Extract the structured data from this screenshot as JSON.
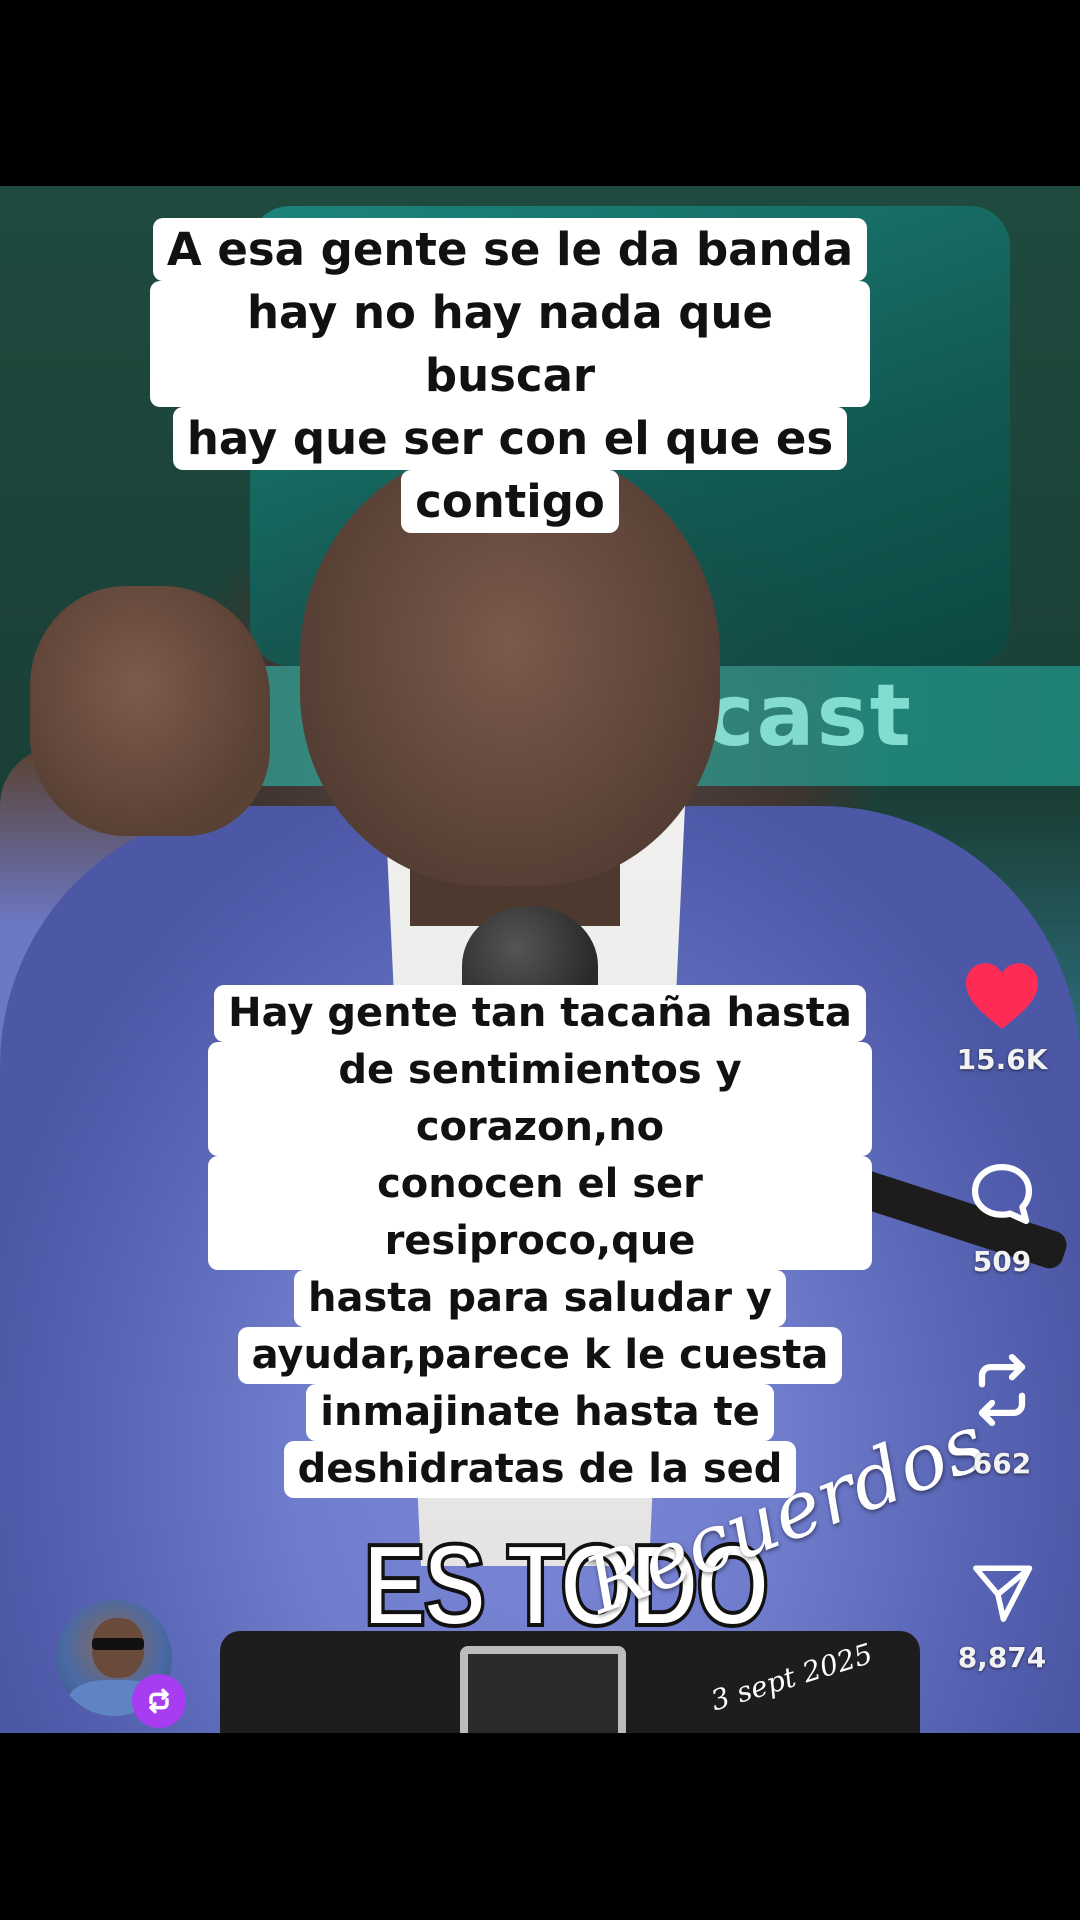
{
  "video": {
    "background_text": "dcast",
    "caption_top": [
      "A esa gente se le da banda",
      "hay no hay nada que buscar",
      "hay que ser con el que es",
      "contigo"
    ],
    "caption_bottom": [
      "Hay gente tan tacaña hasta",
      "de sentimientos y corazon,no",
      "conocen el ser resiproco,que",
      "hasta para saludar y",
      "ayudar,parece k le cuesta",
      "inmajinate hasta te",
      "deshidratas de la sed"
    ],
    "overlay_text": "ES TODO",
    "watermark": "Recuerdos",
    "watermark_date": "3 sept 2025"
  },
  "actions": {
    "like": {
      "icon": "heart-icon",
      "count": "15.6K",
      "color": "#fe2c55"
    },
    "comment": {
      "icon": "comment-icon",
      "count": "509"
    },
    "repost": {
      "icon": "repost-icon",
      "count": "662"
    },
    "share": {
      "icon": "share-icon",
      "count": "8,874"
    }
  },
  "creator": {
    "avatar_icon": "avatar",
    "badge_icon": "repost-icon",
    "badge_color": "#a73cf0"
  }
}
